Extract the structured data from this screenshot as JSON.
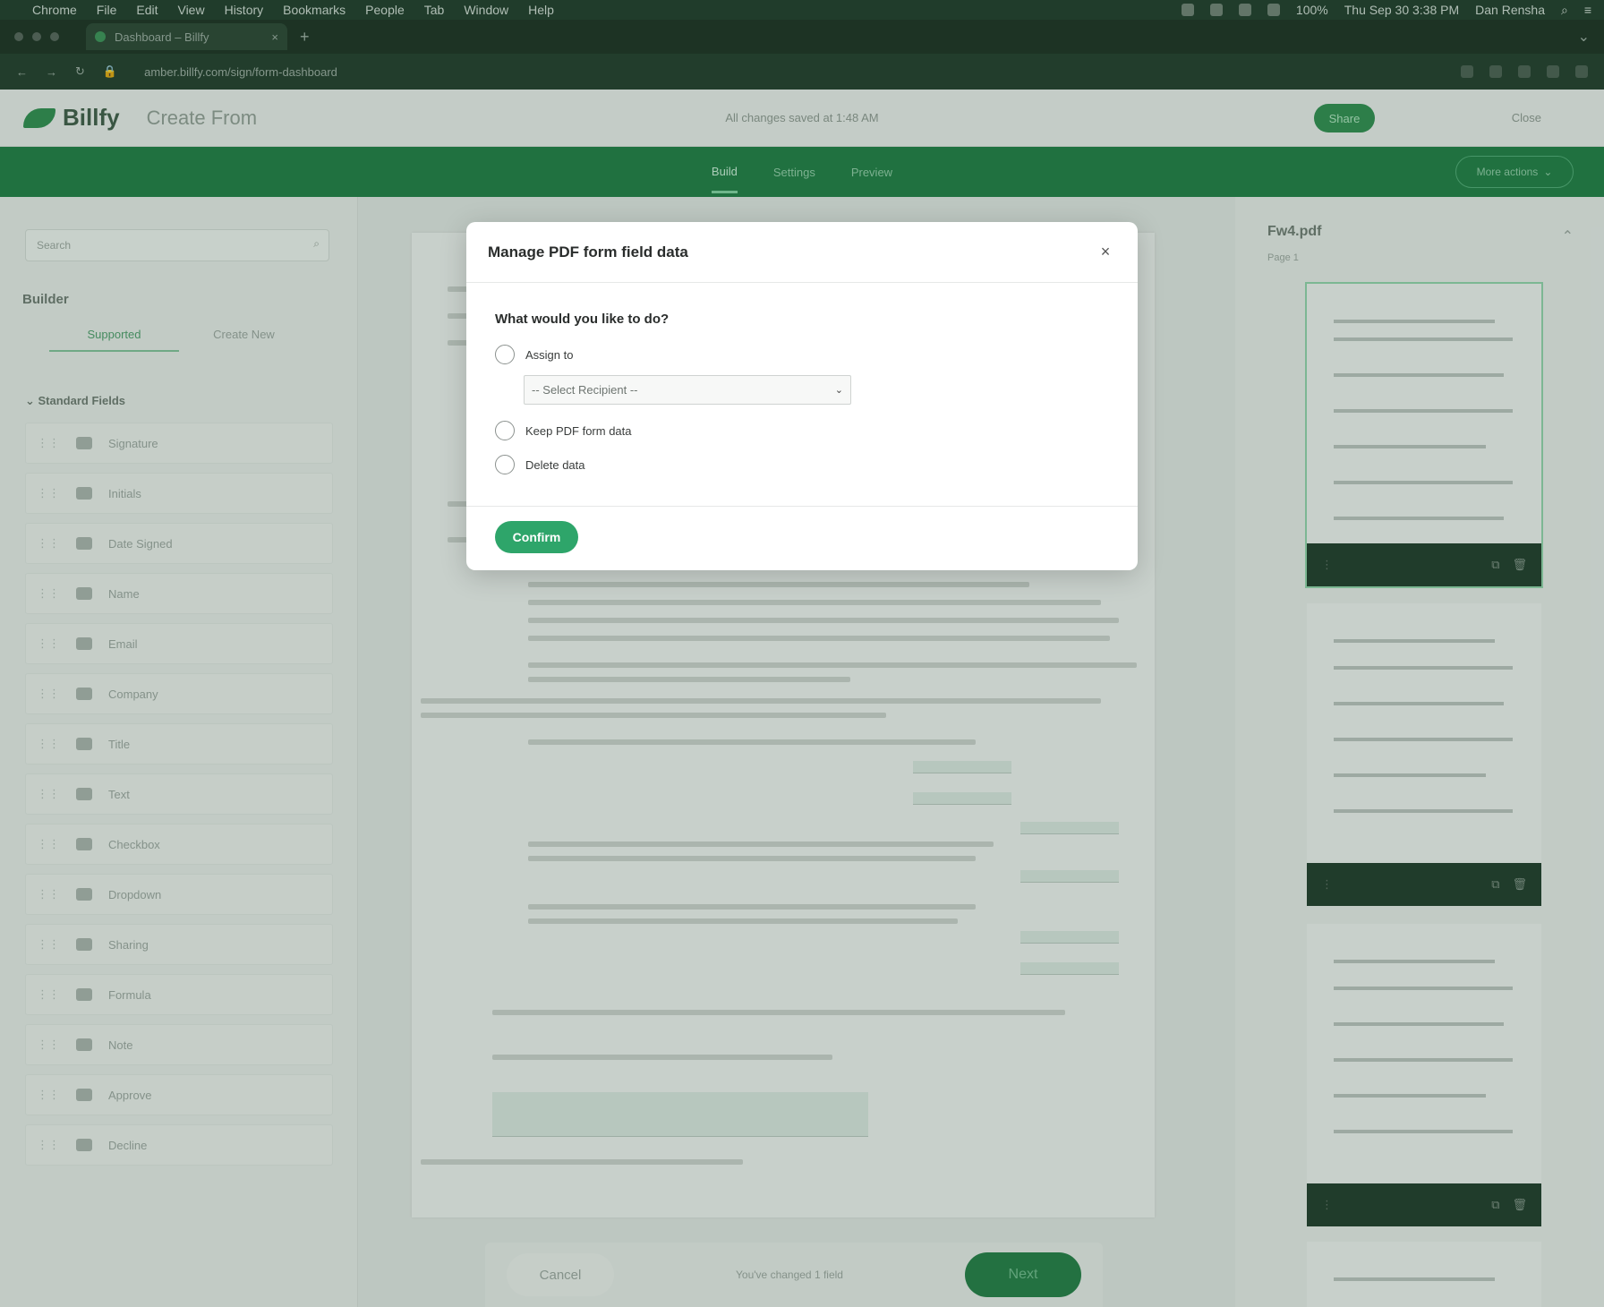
{
  "menubar": {
    "apple": "",
    "items": [
      "Chrome",
      "File",
      "Edit",
      "View",
      "History",
      "Bookmarks",
      "People",
      "Tab",
      "Window",
      "Help"
    ],
    "datetime": "Thu Sep 30  3:38 PM",
    "user": "Dan Rensha",
    "battery": "100%"
  },
  "browser": {
    "tab_title": "Dashboard – Billfy",
    "url": "amber.billfy.com/sign/form-dashboard"
  },
  "app": {
    "logo_text": "Billfy",
    "title": "Create From",
    "saved_status": "All changes saved at 1:48 AM",
    "share_label": "Share",
    "close_label": "Close"
  },
  "subnav": {
    "tabs": [
      "Build",
      "Settings",
      "Preview"
    ],
    "more_actions": "More actions"
  },
  "builder": {
    "search_placeholder": "Search",
    "heading": "Builder",
    "tabs": [
      "Supported",
      "Create New"
    ],
    "section_title": "Standard Fields",
    "items": [
      "Signature",
      "Initials",
      "Date Signed",
      "Name",
      "Email",
      "Company",
      "Title",
      "Text",
      "Checkbox",
      "Dropdown",
      "Sharing",
      "Formula",
      "Note",
      "Approve",
      "Decline"
    ]
  },
  "document": {
    "cancel_label": "Cancel",
    "changes_label": "You've changed 1 field",
    "next_label": "Next"
  },
  "thumbnails": {
    "file_name": "Fw4.pdf",
    "pages_label": "Page 1"
  },
  "modal": {
    "title": "Manage PDF form field data",
    "question": "What would you like to do?",
    "option_assign": "Assign to",
    "select_placeholder": "-- Select Recipient --",
    "option_keep": "Keep PDF form data",
    "option_delete": "Delete data",
    "confirm_label": "Confirm",
    "close_glyph": "×"
  },
  "colors": {
    "brand_green": "#2ea56a",
    "nav_green": "#1f7a44",
    "dark_chrome": "#1b2f22"
  }
}
